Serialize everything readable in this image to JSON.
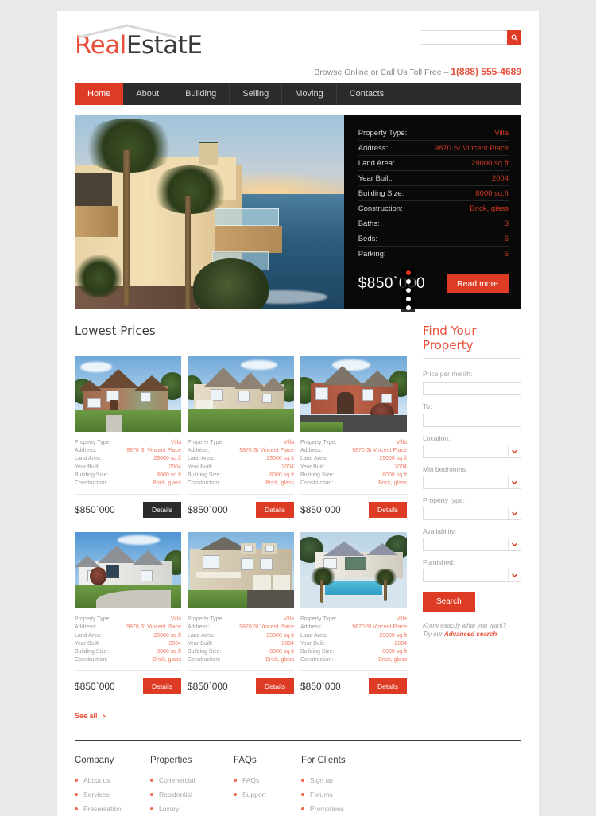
{
  "header": {
    "logo": {
      "part1": "Real",
      "part2": "EstatE",
      "roof_icon": "house-roof-icon"
    },
    "search": {
      "value": "",
      "placeholder": "",
      "icon": "search-icon"
    },
    "tagline_prefix": "Browse Online or Call Us Toll Free – ",
    "phone": "1(888) 555-4689"
  },
  "nav": {
    "items": [
      {
        "label": "Home",
        "active": true
      },
      {
        "label": "About",
        "active": false
      },
      {
        "label": "Building",
        "active": false
      },
      {
        "label": "Selling",
        "active": false
      },
      {
        "label": "Moving",
        "active": false
      },
      {
        "label": "Contacts",
        "active": false
      }
    ]
  },
  "hero": {
    "image_alt": "beachfront-villa-sunset",
    "specs": [
      {
        "label": "Property Type:",
        "value": "Villa"
      },
      {
        "label": "Address:",
        "value": "9870 St Vincent Place"
      },
      {
        "label": "Land Area:",
        "value": "29000 sq.ft"
      },
      {
        "label": "Year Built:",
        "value": "2004"
      },
      {
        "label": "Building Size:",
        "value": "8000 sq.ft"
      },
      {
        "label": "Construction:",
        "value": "Brick, glass"
      },
      {
        "label": "Baths:",
        "value": "3"
      },
      {
        "label": "Beds:",
        "value": "6"
      },
      {
        "label": "Parking:",
        "value": "5"
      }
    ],
    "price": "$850`000",
    "read_more_label": "Read more",
    "slider_dots": 5,
    "active_dot": 0
  },
  "listings": {
    "title": "Lowest Prices",
    "see_all_label": "See all",
    "cards": [
      {
        "image_alt": "brick-suburban-house",
        "specs": [
          {
            "label": "Property Type:",
            "value": "Villa"
          },
          {
            "label": "Address:",
            "value": "9870 St Vincent Place"
          },
          {
            "label": "Land Area:",
            "value": "29000 sq.ft"
          },
          {
            "label": "Year Built:",
            "value": "2004"
          },
          {
            "label": "Building Size:",
            "value": "8000 sq.ft"
          },
          {
            "label": "Construction:",
            "value": "Brick, glass"
          }
        ],
        "price": "$850`000",
        "details_label": "Details",
        "details_hover": true
      },
      {
        "image_alt": "stone-mansion",
        "specs": [
          {
            "label": "Property Type:",
            "value": "Villa"
          },
          {
            "label": "Address:",
            "value": "9870 St Vincent Place"
          },
          {
            "label": "Land Area:",
            "value": "29000 sq.ft"
          },
          {
            "label": "Year Built:",
            "value": "2004"
          },
          {
            "label": "Building Size:",
            "value": "8000 sq.ft"
          },
          {
            "label": "Construction:",
            "value": "Brick, glass"
          }
        ],
        "price": "$850`000",
        "details_label": "Details",
        "details_hover": false
      },
      {
        "image_alt": "red-brick-colonial",
        "specs": [
          {
            "label": "Property Type:",
            "value": "Villa"
          },
          {
            "label": "Address:",
            "value": "9870 St Vincent Place"
          },
          {
            "label": "Land Area:",
            "value": "29000 sq.ft"
          },
          {
            "label": "Year Built:",
            "value": "2004"
          },
          {
            "label": "Building Size:",
            "value": "8000 sq.ft"
          },
          {
            "label": "Construction:",
            "value": "Brick, glass"
          }
        ],
        "price": "$850`000",
        "details_label": "Details",
        "details_hover": false
      },
      {
        "image_alt": "white-house-driveway",
        "specs": [
          {
            "label": "Property Type:",
            "value": "Villa"
          },
          {
            "label": "Address:",
            "value": "9870 St Vincent Place"
          },
          {
            "label": "Land Area:",
            "value": "29000 sq.ft"
          },
          {
            "label": "Year Built:",
            "value": "2004"
          },
          {
            "label": "Building Size:",
            "value": "8000 sq.ft"
          },
          {
            "label": "Construction:",
            "value": "Brick, glass"
          }
        ],
        "price": "$850`000",
        "details_label": "Details",
        "details_hover": false
      },
      {
        "image_alt": "beige-colonial-porch",
        "specs": [
          {
            "label": "Property Type:",
            "value": "Villa"
          },
          {
            "label": "Address:",
            "value": "9870 St Vincent Place"
          },
          {
            "label": "Land Area:",
            "value": "29000 sq.ft"
          },
          {
            "label": "Year Built:",
            "value": "2004"
          },
          {
            "label": "Building Size:",
            "value": "8000 sq.ft"
          },
          {
            "label": "Construction:",
            "value": "Brick, glass"
          }
        ],
        "price": "$850`000",
        "details_label": "Details",
        "details_hover": false
      },
      {
        "image_alt": "pool-villa",
        "specs": [
          {
            "label": "Property Type:",
            "value": "Villa"
          },
          {
            "label": "Address:",
            "value": "9870 St Vincent Place"
          },
          {
            "label": "Land Area:",
            "value": "29000 sq.ft"
          },
          {
            "label": "Year Built:",
            "value": "2004"
          },
          {
            "label": "Building Size:",
            "value": "8000 sq.ft"
          },
          {
            "label": "Construction:",
            "value": "Brick, glass"
          }
        ],
        "price": "$850`000",
        "details_label": "Details",
        "details_hover": false
      }
    ]
  },
  "sidebar": {
    "title": "Find Your Property",
    "fields": [
      {
        "label": "Price per month:",
        "type": "input",
        "value": ""
      },
      {
        "label": "To:",
        "type": "input",
        "value": ""
      },
      {
        "label": "Location:",
        "type": "select",
        "value": ""
      },
      {
        "label": "Min bedrooms:",
        "type": "select",
        "value": ""
      },
      {
        "label": "Property type:",
        "type": "select",
        "value": ""
      },
      {
        "label": "Availability:",
        "type": "select",
        "value": ""
      },
      {
        "label": "Furnished:",
        "type": "select",
        "value": ""
      }
    ],
    "search_label": "Search",
    "hint_line1": "Know exactly what you want?",
    "hint_line2_prefix": "Try our ",
    "hint_link": "Advanced search"
  },
  "footer": {
    "columns": [
      {
        "title": "Company",
        "items": [
          "About us",
          "Services",
          "Presentation"
        ]
      },
      {
        "title": "Properties",
        "items": [
          "Commercial",
          "Residential",
          "Luxury"
        ]
      },
      {
        "title": "FAQs",
        "items": [
          "FAQs",
          "Support"
        ]
      },
      {
        "title": "For Clients",
        "items": [
          "Sign up",
          "Forums",
          "Promotions"
        ]
      }
    ]
  },
  "colors": {
    "accent_red": "#dd3b23",
    "logo_red": "#e8503a",
    "spec_red": "#d13a22",
    "card_spec_red": "#ef7a62",
    "nav_dark": "#2b2b2b",
    "page_bg": "#e9e9e9"
  }
}
